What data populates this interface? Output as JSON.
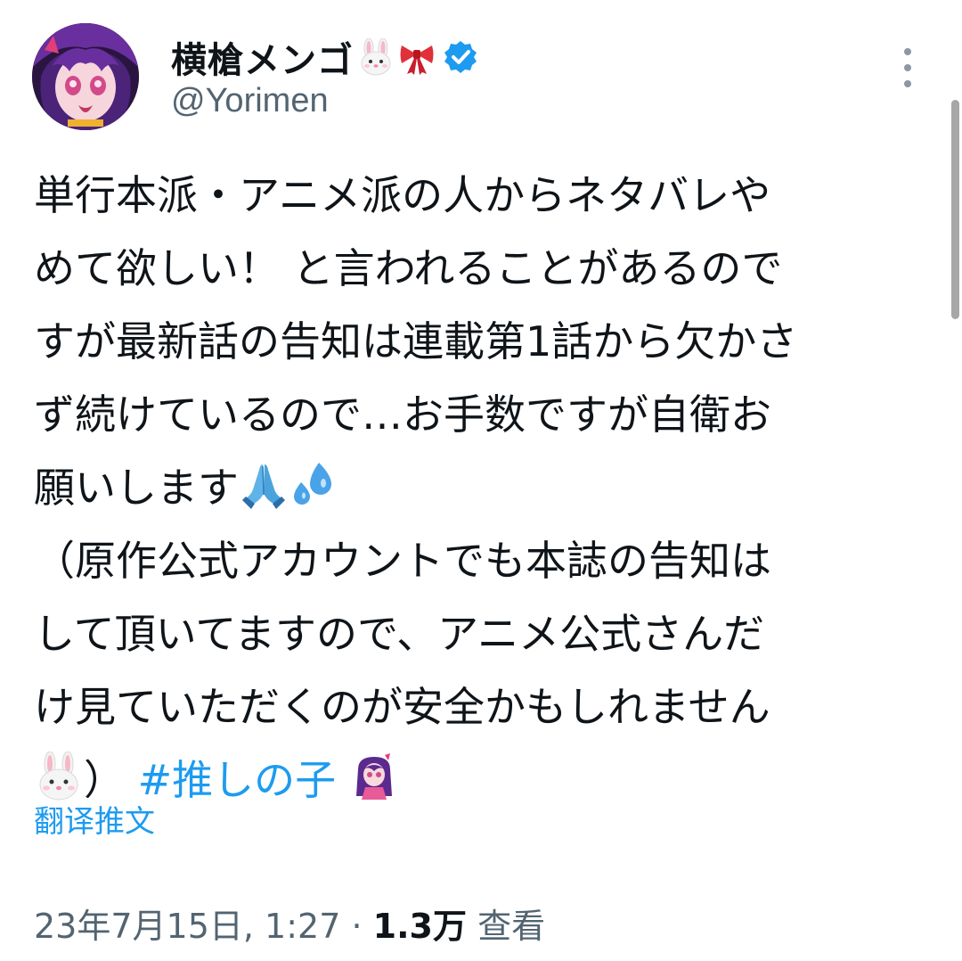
{
  "user": {
    "display_name": "横槍メンゴ",
    "name_emojis": [
      "rabbit-face-icon",
      "ribbon-icon"
    ],
    "verified": true,
    "handle": "@Yorimen"
  },
  "tweet": {
    "lines": [
      "単行本派・アニメ派の人からネタバレや",
      "めて欲しい！ と言われることがあるので",
      "すが最新話の告知は連載第1話から欠かさ",
      "ず続けているので…お手数ですが自衛お",
      "願いします",
      "（原作公式アカウントでも本誌の告知は",
      "して頂いてますので、アニメ公式さんだ",
      "け見ていただくのが安全かもしれません",
      "）"
    ],
    "hashtag": "#推しの子",
    "line_emojis": {
      "line5": [
        "folded-hands-icon",
        "sweat-droplets-icon"
      ],
      "line9_start": "rabbit-face-icon",
      "hashtag_after": "anime-character-emoji"
    }
  },
  "translate_label": "翻译推文",
  "meta": {
    "date_time": "23年7月15日, 1:27",
    "separator": "·",
    "views_count": "1.3万",
    "views_label": "查看"
  },
  "colors": {
    "link": "#1d9bf0",
    "secondary_text": "#536471",
    "verified": "#1d9bf0"
  }
}
